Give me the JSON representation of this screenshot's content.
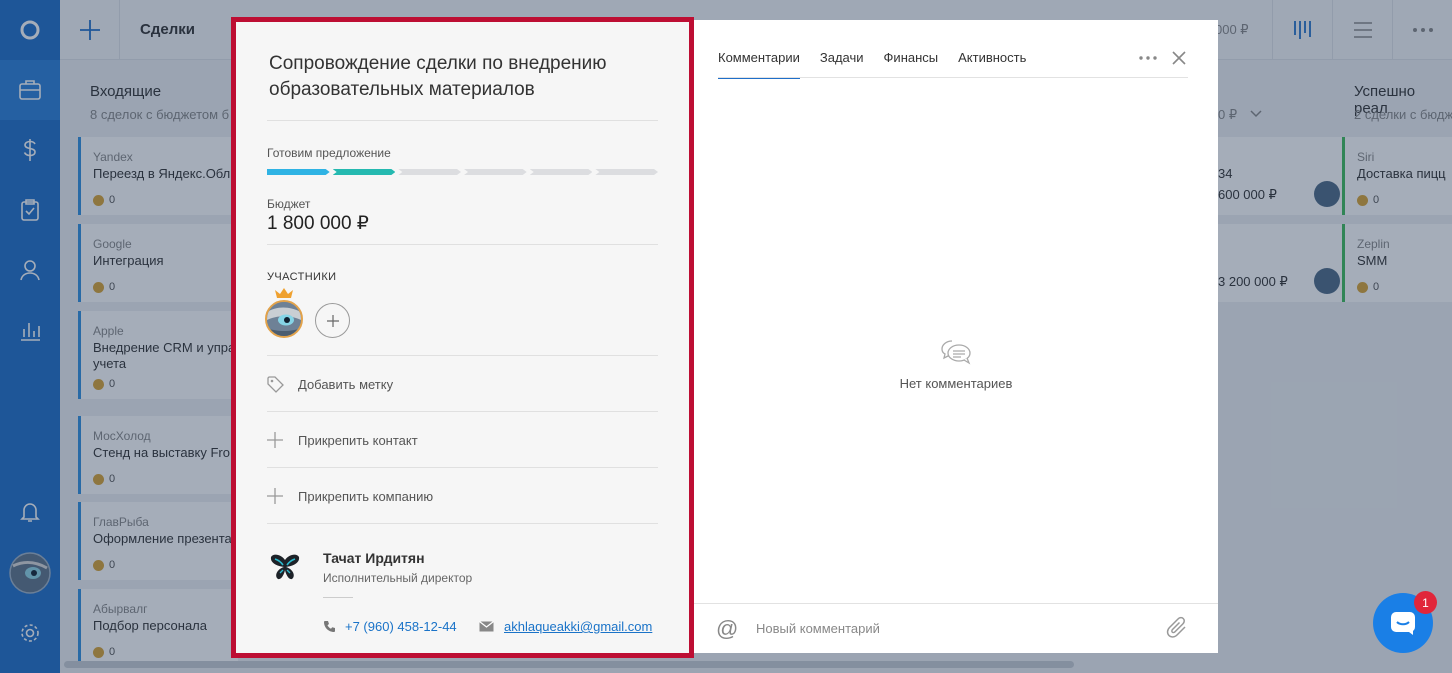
{
  "background": {
    "topbar": {
      "title": "Сделки",
      "sum_partial": "000 ₽"
    },
    "columns": [
      {
        "title": "Входящие",
        "subtitle": "8 сделок с бюджетом б"
      },
      {
        "title": "Успешно реал",
        "subtitle": "2 сделки с бюдж"
      }
    ],
    "middle_column_sub": "0 ₽",
    "cards": [
      {
        "company": "Yandex",
        "name": "Переезд в Яндекс.Обл",
        "count": "0"
      },
      {
        "company": "Google",
        "name": "Интеграция",
        "count": "0"
      },
      {
        "company": "Apple",
        "name": "Внедрение CRM и упра учета",
        "count": "0"
      },
      {
        "company": "МосХолод",
        "name": "Стенд на выставку Fro",
        "count": "0"
      },
      {
        "company": "ГлавРыба",
        "name": "Оформление презента",
        "count": "0"
      },
      {
        "company": "Абырвалг",
        "name": "Подбор персонала",
        "count": "0"
      }
    ],
    "right_cards": [
      {
        "title_partial": "34",
        "amount": "600 000 ₽"
      },
      {
        "title_partial": "",
        "amount": "3 200 000 ₽"
      }
    ],
    "won_cards": [
      {
        "company": "Siri",
        "name": "Доставка пицц",
        "count": "0"
      },
      {
        "company": "Zeplin",
        "name": "SMM",
        "count": "0"
      }
    ]
  },
  "deal": {
    "title": "Сопровождение сделки по внедрению образовательных материалов",
    "stage": {
      "label": "Готовим предложение",
      "total": 6,
      "completed": 2,
      "colors": [
        "#2fb3e4",
        "#25b9b0"
      ]
    },
    "budget_label": "Бюджет",
    "budget_value": "1 800 000 ₽",
    "participants_label": "УЧАСТНИКИ",
    "add_tag": "Добавить метку",
    "attach_contact": "Прикрепить контакт",
    "attach_company": "Прикрепить компанию",
    "contact": {
      "name": "Тачат Ирдитян",
      "role": "Исполнительный директор",
      "phone": "+7 (960) 458-12-44",
      "email": "akhlaqueakki@gmail.com"
    }
  },
  "panel": {
    "tabs": [
      "Комментарии",
      "Задачи",
      "Финансы",
      "Активность"
    ],
    "active_tab": "Комментарии",
    "empty_text": "Нет комментариев",
    "comment_placeholder": "Новый комментарий"
  },
  "chat": {
    "badge": "1"
  },
  "colors": {
    "sidebar": "#1f6fc9",
    "highlight_border": "#bd0e33",
    "accent": "#1f6fc9",
    "link": "#1a73c8"
  }
}
